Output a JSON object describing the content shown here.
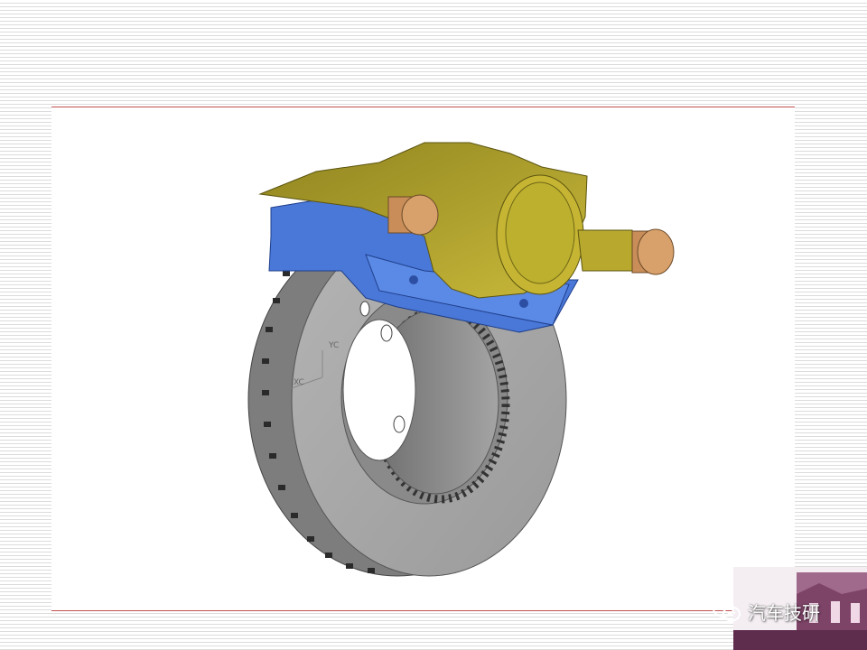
{
  "figure": {
    "description_icon": "brake-disc-caliper-cad-model",
    "axis_labels": {
      "y": "YC",
      "x": "XC"
    },
    "colors": {
      "caliper": "#b8a92e",
      "bracket": "#4a78d8",
      "pins": "#d8a06a",
      "disc": "#a9a9a9"
    }
  },
  "watermark": {
    "icon": "wechat-icon",
    "text": "汽车技研"
  },
  "theme": {
    "rule_color": "#c0504d"
  }
}
